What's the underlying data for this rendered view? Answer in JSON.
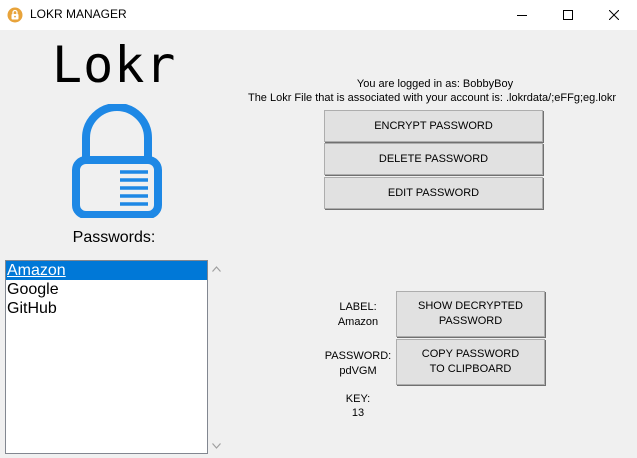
{
  "window": {
    "title": "LOKR MANAGER",
    "icon": "lock-app-icon"
  },
  "brand": {
    "name": "Lokr"
  },
  "lock_icon": {
    "name": "padlock-icon",
    "color": "#1e88e5"
  },
  "sidebar": {
    "passwords_label": "Passwords:",
    "items": [
      "Amazon",
      "Google",
      "GitHub"
    ],
    "selected": "Amazon"
  },
  "account": {
    "logged_in_text": "You are logged in as: BobbyBoy",
    "lokr_file_text": "The Lokr File that is associated with your account is: .lokrdata/;eFFg;eg.lokr"
  },
  "actions": {
    "encrypt": "ENCRYPT PASSWORD",
    "delete": "DELETE PASSWORD",
    "edit": "EDIT PASSWORD",
    "show_decrypted_line1": "SHOW DECRYPTED",
    "show_decrypted_line2": "PASSWORD",
    "copy_line1": "COPY PASSWORD",
    "copy_line2": "TO CLIPBOARD"
  },
  "details": {
    "label_caption": "LABEL:",
    "label_value": "Amazon",
    "password_caption": "PASSWORD:",
    "password_value": "pdVGM",
    "key_caption": "KEY:",
    "key_value": "13"
  },
  "colors": {
    "accent": "#1e88e5",
    "selection": "#0078d7"
  }
}
